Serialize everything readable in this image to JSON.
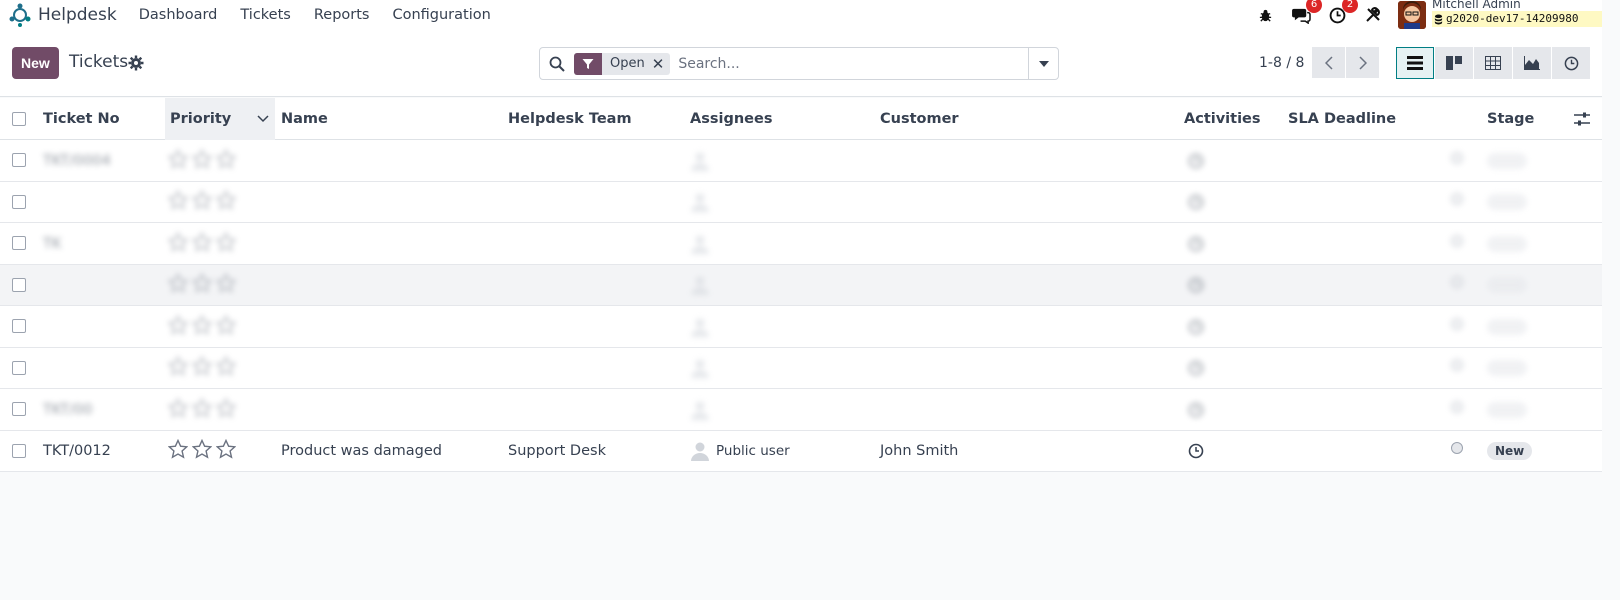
{
  "app": {
    "name": "Helpdesk",
    "menu": [
      "Dashboard",
      "Tickets",
      "Reports",
      "Configuration"
    ]
  },
  "systray": {
    "messages_count": "6",
    "activities_count": "2",
    "user_name": "Mitchell Admin",
    "database": "g2020-dev17-14209980"
  },
  "control_panel": {
    "new_label": "New",
    "title": "Tickets",
    "facet_label": "Open",
    "search_placeholder": "Search...",
    "pager": "1-8 / 8"
  },
  "columns": [
    "Ticket No",
    "Priority",
    "Name",
    "Helpdesk Team",
    "Assignees",
    "Customer",
    "Activities",
    "SLA Deadline",
    "Stage"
  ],
  "rows": [
    {
      "ticket_no": "TKT/0004",
      "priority_stars": 3,
      "name": "",
      "team": "",
      "assignee": "",
      "customer": "",
      "stage": ""
    },
    {
      "ticket_no": "",
      "priority_stars": 3,
      "name": "",
      "team": "",
      "assignee": "",
      "customer": "",
      "stage": ""
    },
    {
      "ticket_no": "TK",
      "priority_stars": 0,
      "name": "",
      "team": "",
      "assignee": "",
      "customer": "",
      "stage": ""
    },
    {
      "ticket_no": "",
      "priority_stars": 0,
      "name": "",
      "team": "",
      "assignee": "",
      "customer": "",
      "stage": ""
    },
    {
      "ticket_no": "",
      "priority_stars": 0,
      "name": "",
      "team": "",
      "assignee": "",
      "customer": "",
      "stage": ""
    },
    {
      "ticket_no": "",
      "priority_stars": 3,
      "name": "",
      "team": "",
      "assignee": "",
      "customer": "",
      "stage": ""
    },
    {
      "ticket_no": "TKT/00",
      "priority_stars": 3,
      "name": "",
      "team": "",
      "assignee": "",
      "customer": "",
      "stage": ""
    },
    {
      "ticket_no": "TKT/0012",
      "priority_stars": 3,
      "name": "Product was damaged",
      "team": "Support Desk",
      "assignee": "Public user",
      "customer": "John Smith",
      "stage": "New"
    }
  ],
  "colors": {
    "brand": "#714b67",
    "active_view": "#017e84",
    "badge": "#dc2626",
    "db_highlight": "#fef9c3"
  },
  "icons": {
    "bug": "bug-icon",
    "messages": "chat-icon",
    "activities": "clock-icon",
    "tools": "tools-icon",
    "gear": "gear-icon",
    "search": "search-icon",
    "filter": "filter-icon"
  }
}
